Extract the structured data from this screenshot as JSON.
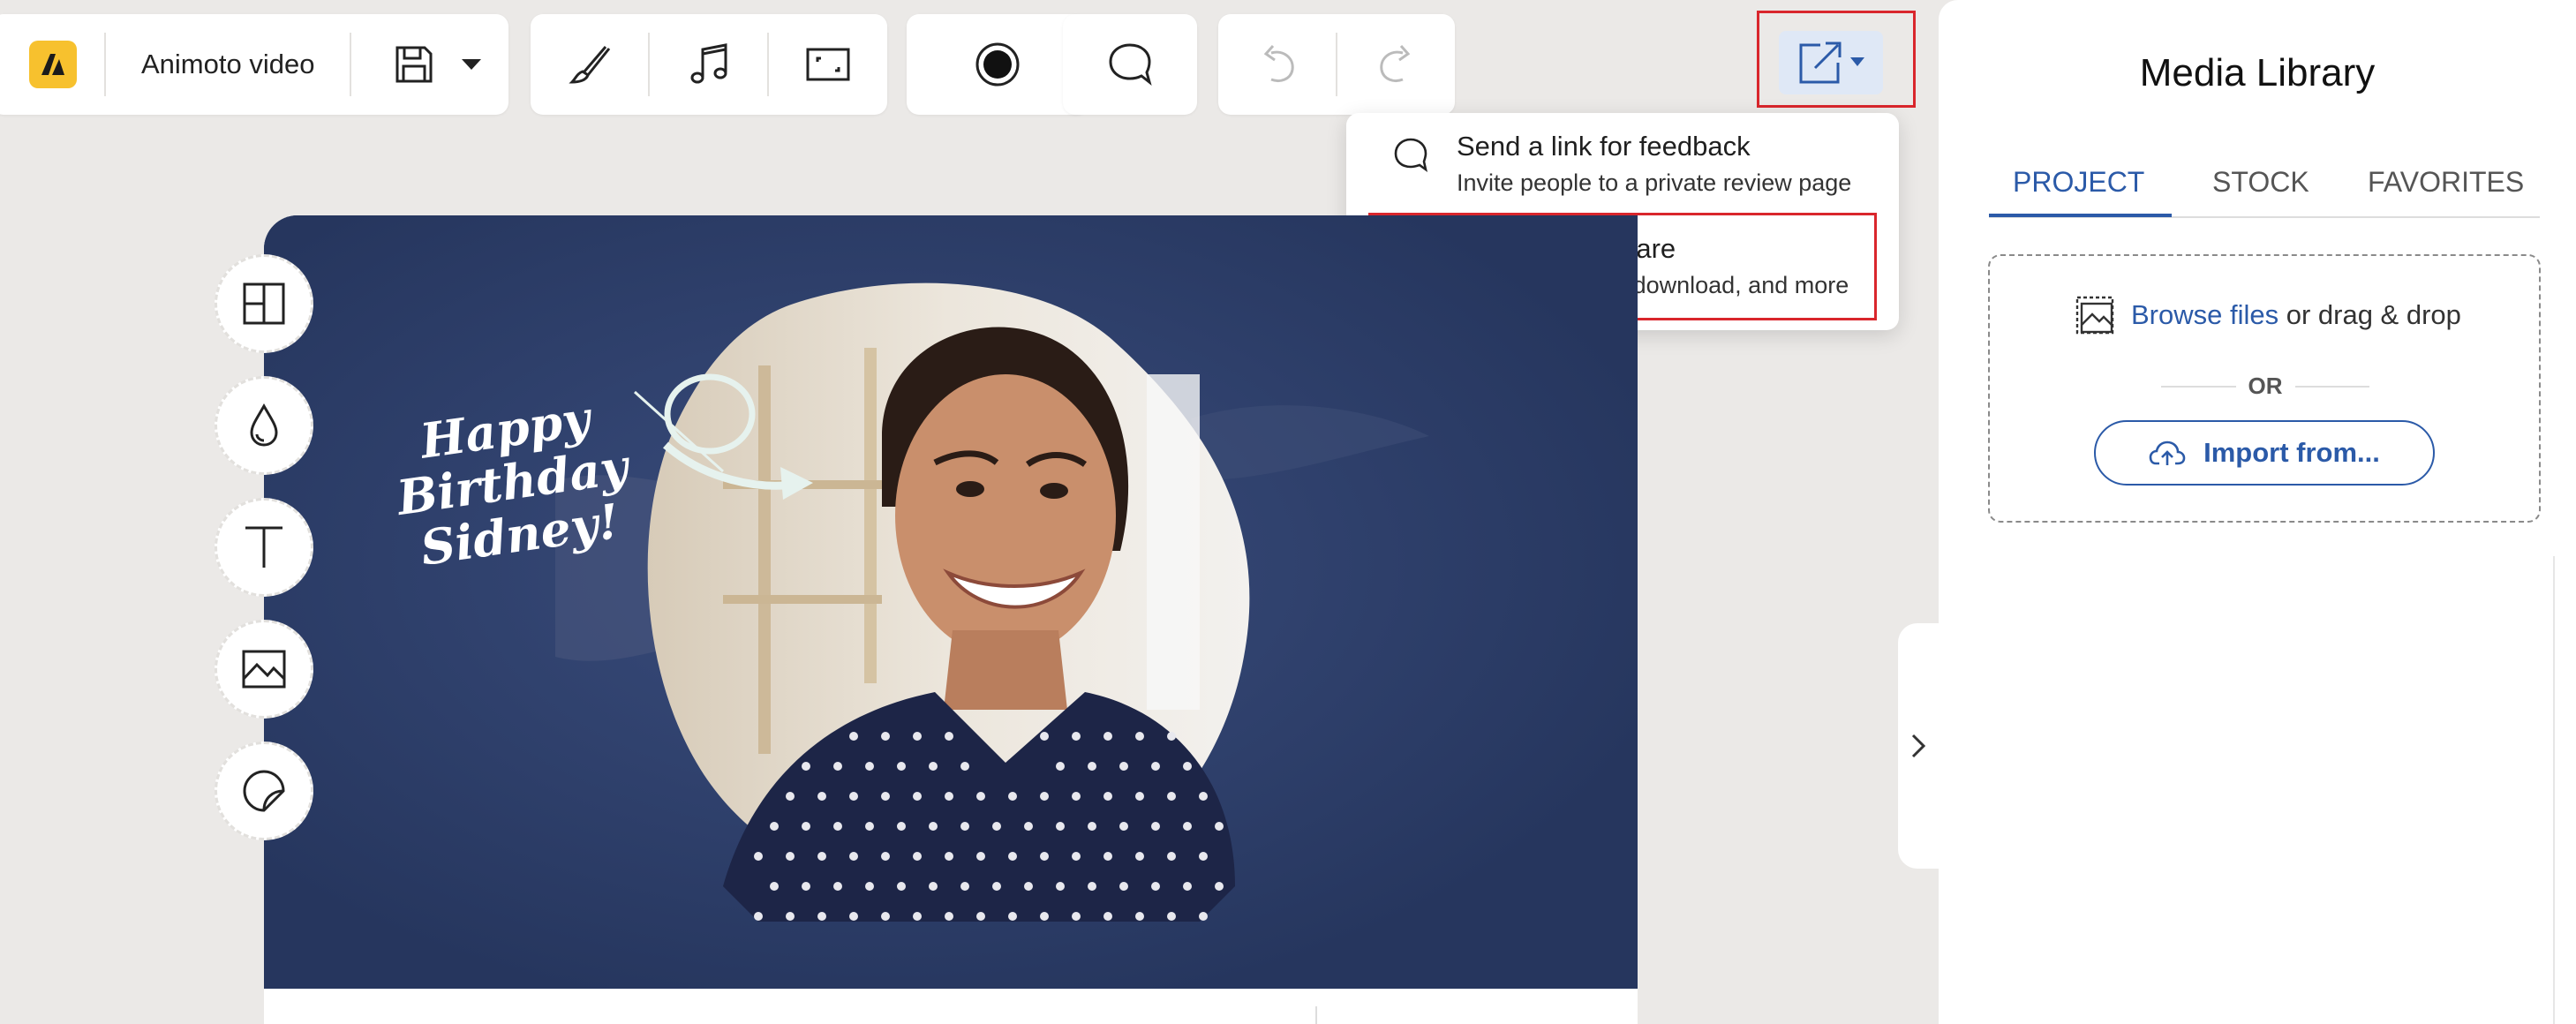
{
  "toolbar": {
    "project_name": "Animoto video"
  },
  "share_menu": {
    "items": [
      {
        "title": "Send a link for feedback",
        "subtitle": "Invite people to a private review page"
      },
      {
        "title": "Publish and share",
        "subtitle": "Export to social, download, and more"
      }
    ]
  },
  "canvas": {
    "greeting_lines": [
      "Happy",
      "Birthday",
      "Sidney!"
    ]
  },
  "panel": {
    "title": "Media Library",
    "tabs": [
      {
        "label": "PROJECT",
        "active": true
      },
      {
        "label": "STOCK",
        "active": false
      },
      {
        "label": "FAVORITES",
        "active": false
      }
    ],
    "browse_link": "Browse files",
    "drag_text": " or drag & drop",
    "or_text": "OR",
    "import_label": "Import from..."
  },
  "colors": {
    "accent": "#2b5aa8",
    "logo": "#f7c12e",
    "canvas_bg": "#2d3f6d",
    "highlight": "#d9262c"
  }
}
